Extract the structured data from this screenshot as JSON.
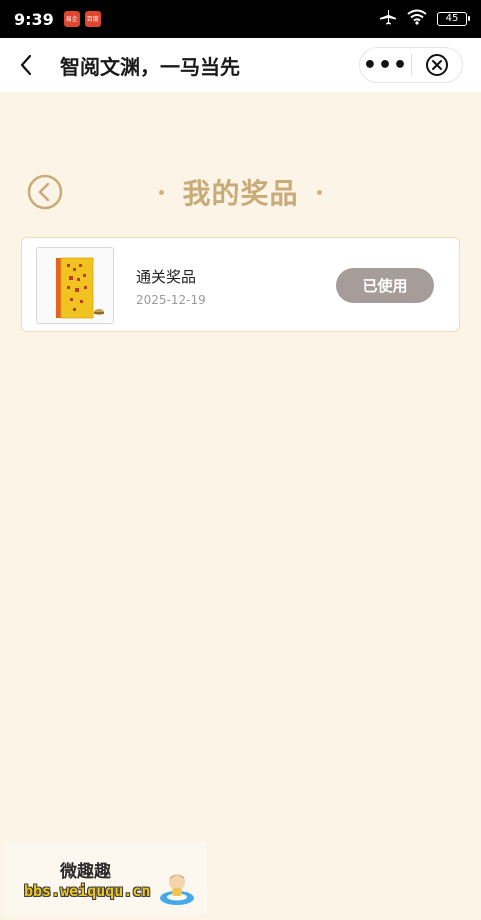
{
  "status_bar": {
    "time": "9:39",
    "badge1": "易企",
    "badge2": "百度",
    "battery": "45"
  },
  "nav": {
    "title": "智阅文渊，一马当先",
    "more_label": "•••"
  },
  "page": {
    "title": "我的奖品"
  },
  "prizes": [
    {
      "name": "通关奖品",
      "date": "2025-12-19",
      "status": "已使用"
    }
  ],
  "watermark": {
    "title": "微趣趣",
    "url": "bbs.weiququ.cn"
  },
  "colors": {
    "background": "#FCF4E7",
    "title_gold": "#C9AB78",
    "used_button": "#A69C9A",
    "card_border": "#EEDCBB"
  }
}
